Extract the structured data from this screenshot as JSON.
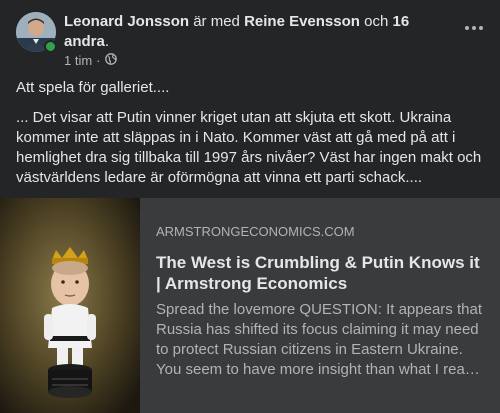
{
  "post": {
    "author": "Leonard Jonsson",
    "with_text": "är med",
    "tagged": "Reine Evensson",
    "and_text": "och",
    "others": "16 andra",
    "time": "1 tim",
    "separator": "·",
    "audience_icon": "globe-icon",
    "text": [
      "Att spela för galleriet....",
      "... Det visar att Putin vinner kriget utan att skjuta ett skott. Ukraina kommer inte att släppas in i Nato. Kommer väst att gå med på att i hemlighet dra sig tillbaka till 1997 års nivåer? Väst har ingen makt och västvärldens ledare är oförmögna att vinna ett parti schack...."
    ]
  },
  "link": {
    "domain": "ARMSTRONGECONOMICS.COM",
    "title": "The West is Crumbling & Putin Knows it | Armstrong Economics",
    "description": "Spread the lovemore QUESTION: It appears that Russia has shifted its focus claiming it may need to protect Russian citizens in Eastern Ukraine. You seem to have more insight than what I read elsewhere. Biden is now scrambling with Borris…"
  },
  "colors": {
    "background": "#242526",
    "card": "#3a3b3c",
    "online": "#31a24c",
    "text": "#e4e6eb",
    "muted": "#b0b3b8"
  }
}
